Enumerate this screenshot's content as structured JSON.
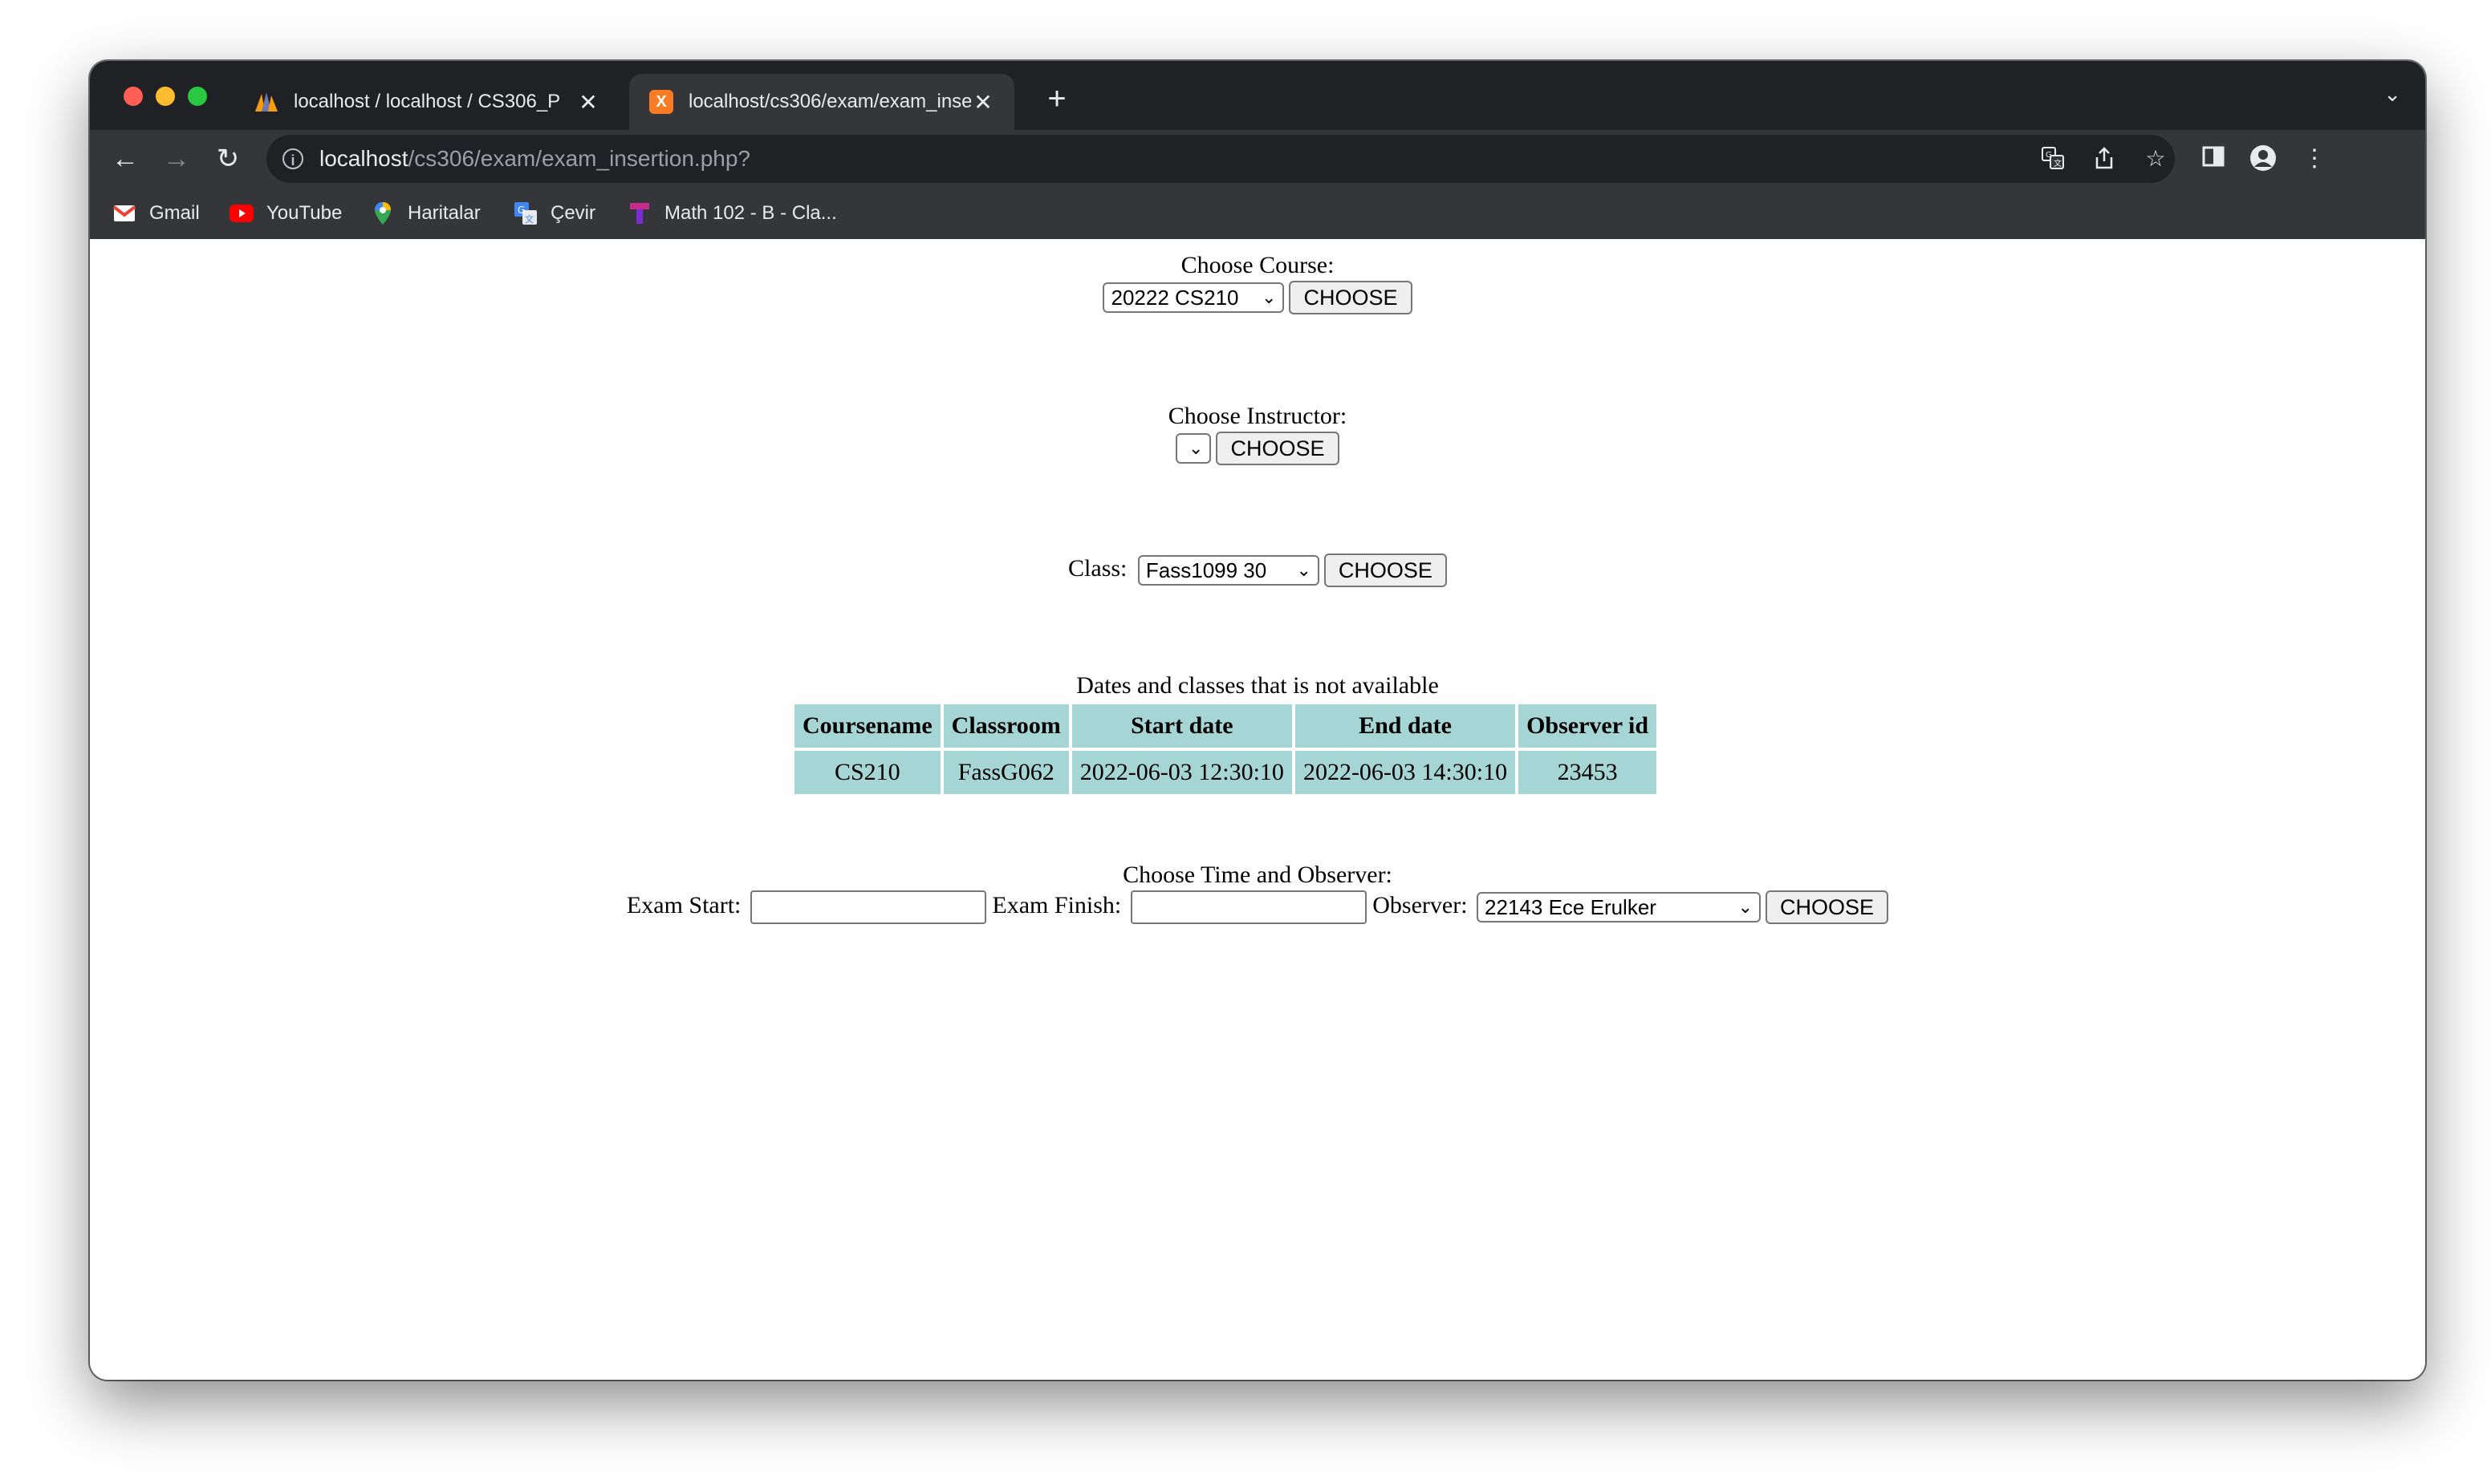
{
  "browser": {
    "tabs": [
      {
        "title": "localhost / localhost / CS306_P",
        "icon": "phpmyadmin-icon",
        "active": false
      },
      {
        "title": "localhost/cs306/exam/exam_insertion.php?",
        "icon": "xampp-icon",
        "active": true
      }
    ],
    "url_host": "localhost",
    "url_path": "/cs306/exam/exam_insertion.php?",
    "bookmarks": [
      {
        "label": "Gmail",
        "icon": "gmail-icon"
      },
      {
        "label": "YouTube",
        "icon": "youtube-icon"
      },
      {
        "label": "Haritalar",
        "icon": "maps-icon"
      },
      {
        "label": "Çevir",
        "icon": "translate-icon"
      },
      {
        "label": "Math 102 - B - Cla...",
        "icon": "classroom-icon"
      }
    ]
  },
  "course": {
    "label": "Choose Course:",
    "selected": "20222 CS210",
    "button": "CHOOSE"
  },
  "instructor": {
    "label": "Choose Instructor:",
    "selected": "",
    "button": "CHOOSE"
  },
  "class": {
    "label": "Class:",
    "selected": "Fass1099 30",
    "button": "CHOOSE"
  },
  "unavailable": {
    "caption": "Dates and classes that is not available",
    "columns": [
      "Coursename",
      "Classroom",
      "Start date",
      "End date",
      "Observer id"
    ],
    "rows": [
      [
        "CS210",
        "FassG062",
        "2022-06-03 12:30:10",
        "2022-06-03 14:30:10",
        "23453"
      ]
    ]
  },
  "time_observer": {
    "heading": "Choose Time and Observer:",
    "exam_start_label": "Exam Start:",
    "exam_start_value": "",
    "exam_finish_label": "Exam Finish:",
    "exam_finish_value": "",
    "observer_label": "Observer:",
    "observer_selected": "22143 Ece Erulker",
    "button": "CHOOSE"
  }
}
